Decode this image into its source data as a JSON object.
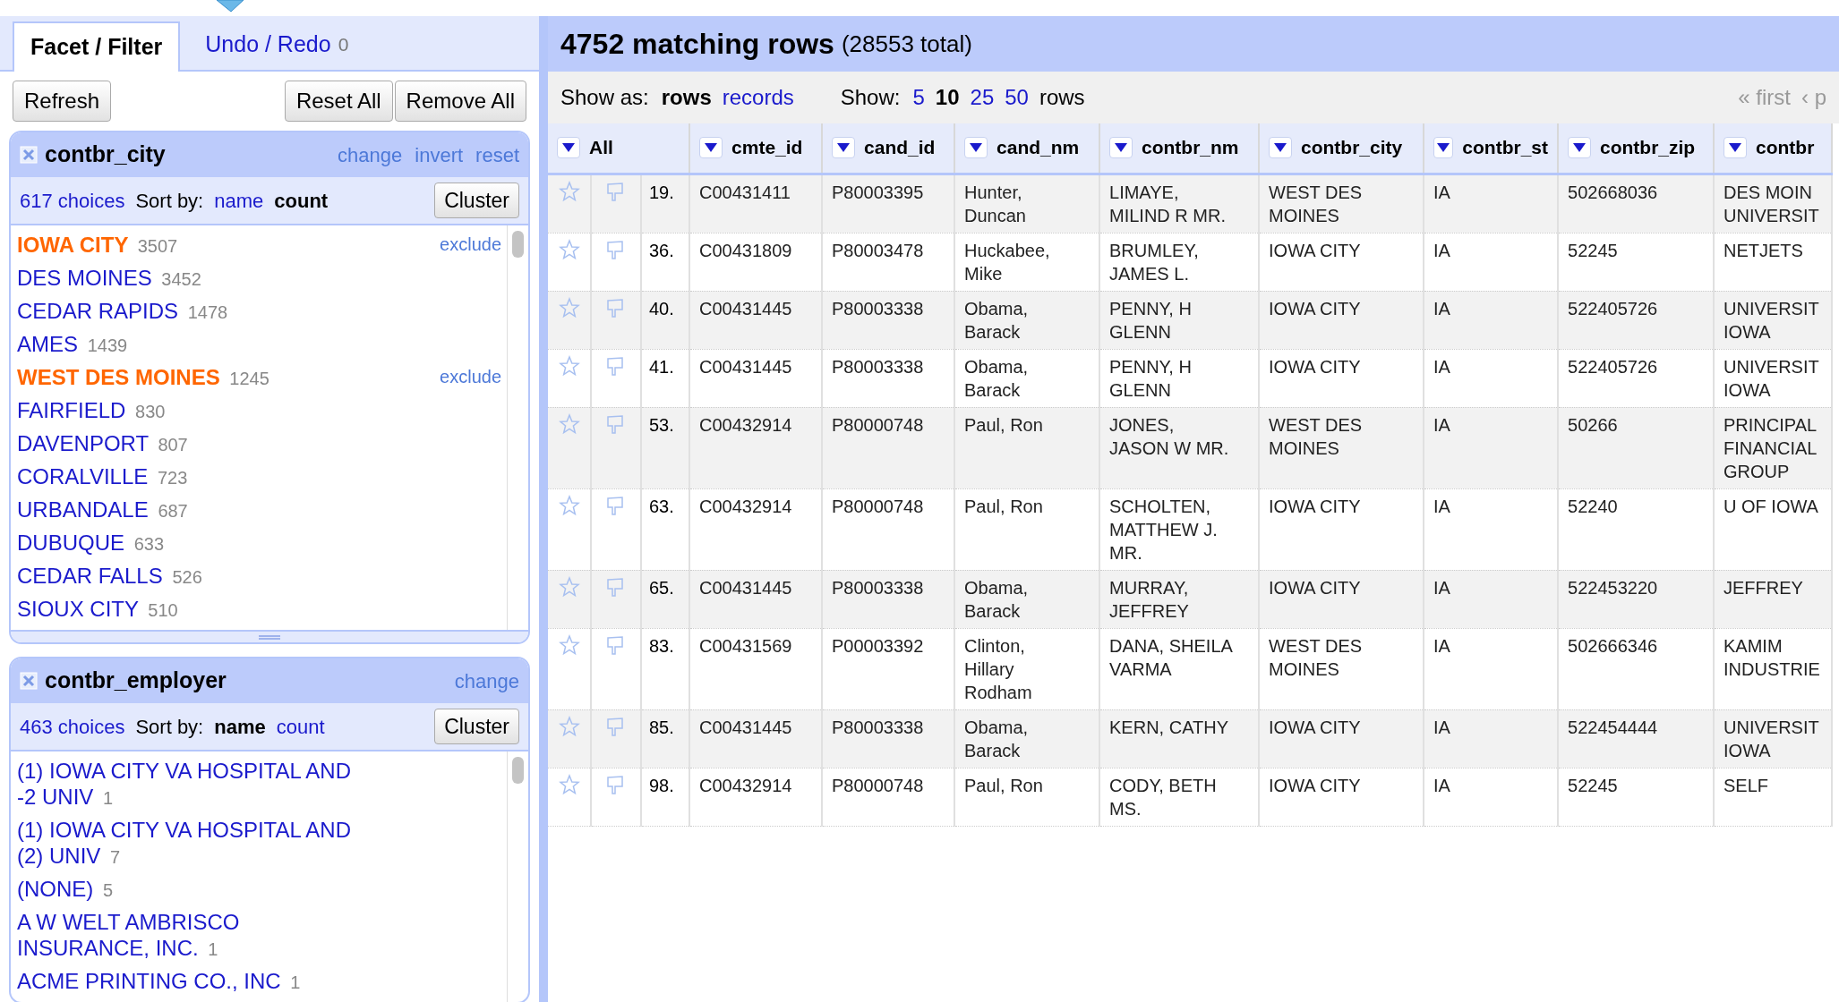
{
  "tabs": [
    {
      "label": "Facet / Filter",
      "selected": true
    },
    {
      "label": "Undo / Redo",
      "count": "0",
      "selected": false
    }
  ],
  "buttons": {
    "left": [
      "Refresh"
    ],
    "right": [
      "Reset All",
      "Remove All"
    ]
  },
  "facets": [
    {
      "title": "contbr_city",
      "actions": [
        "change",
        "invert",
        "reset"
      ],
      "choices": "617 choices",
      "sort_label": "Sort by:",
      "sort": [
        {
          "label": "name",
          "selected": false
        },
        {
          "label": "count",
          "selected": true
        }
      ],
      "cluster": "Cluster",
      "items": [
        {
          "name": "IOWA CITY",
          "count": "3507",
          "selected": true,
          "exclude": "exclude"
        },
        {
          "name": "DES MOINES",
          "count": "3452",
          "selected": false
        },
        {
          "name": "CEDAR RAPIDS",
          "count": "1478",
          "selected": false
        },
        {
          "name": "AMES",
          "count": "1439",
          "selected": false
        },
        {
          "name": "WEST DES MOINES",
          "count": "1245",
          "selected": true,
          "exclude": "exclude"
        },
        {
          "name": "FAIRFIELD",
          "count": "830",
          "selected": false
        },
        {
          "name": "DAVENPORT",
          "count": "807",
          "selected": false
        },
        {
          "name": "CORALVILLE",
          "count": "723",
          "selected": false
        },
        {
          "name": "URBANDALE",
          "count": "687",
          "selected": false
        },
        {
          "name": "DUBUQUE",
          "count": "633",
          "selected": false
        },
        {
          "name": "CEDAR FALLS",
          "count": "526",
          "selected": false
        },
        {
          "name": "SIOUX CITY",
          "count": "510",
          "selected": false
        }
      ]
    },
    {
      "title": "contbr_employer",
      "actions": [
        "change"
      ],
      "choices": "463 choices",
      "sort_label": "Sort by:",
      "sort": [
        {
          "label": "name",
          "selected": true
        },
        {
          "label": "count",
          "selected": false
        }
      ],
      "cluster": "Cluster",
      "items": [
        {
          "name": "(1) IOWA CITY VA HOSPITAL AND -2 UNIV",
          "count": "1",
          "selected": false
        },
        {
          "name": "(1) IOWA CITY VA HOSPITAL AND (2) UNIV",
          "count": "7",
          "selected": false
        },
        {
          "name": "(NONE)",
          "count": "5",
          "selected": false
        },
        {
          "name": "A W WELT AMBRISCO INSURANCE, INC.",
          "count": "1",
          "selected": false
        },
        {
          "name": "ACME PRINTING CO., INC",
          "count": "1",
          "selected": false
        }
      ]
    }
  ],
  "summary": {
    "matching": "4752 matching rows",
    "total": "(28553 total)"
  },
  "view": {
    "show_as_label": "Show as:",
    "modes": [
      {
        "label": "rows",
        "selected": true
      },
      {
        "label": "records",
        "selected": false
      }
    ],
    "show_label": "Show:",
    "page_sizes": [
      {
        "label": "5",
        "selected": false
      },
      {
        "label": "10",
        "selected": true
      },
      {
        "label": "25",
        "selected": false
      },
      {
        "label": "50",
        "selected": false
      }
    ],
    "rows_label": "rows",
    "pager": [
      "« first",
      "‹ p"
    ]
  },
  "table": {
    "columns": [
      "All",
      "cmte_id",
      "cand_id",
      "cand_nm",
      "contbr_nm",
      "contbr_city",
      "contbr_st",
      "contbr_zip",
      "contbr"
    ],
    "rows": [
      {
        "starred": false,
        "flagged": false,
        "cells": [
          "19.",
          "C00431411",
          "P80003395",
          "Hunter,\nDuncan",
          "LIMAYE,\nMILIND R MR.",
          "WEST DES\nMOINES",
          "IA",
          "502668036",
          "DES MOIN\nUNIVERSIT"
        ]
      },
      {
        "starred": false,
        "flagged": false,
        "cells": [
          "36.",
          "C00431809",
          "P80003478",
          "Huckabee,\nMike",
          "BRUMLEY,\nJAMES L.",
          "IOWA CITY",
          "IA",
          "52245",
          "NETJETS"
        ]
      },
      {
        "starred": false,
        "flagged": false,
        "cells": [
          "40.",
          "C00431445",
          "P80003338",
          "Obama,\nBarack",
          "PENNY, H\nGLENN",
          "IOWA CITY",
          "IA",
          "522405726",
          "UNIVERSIT\nIOWA"
        ]
      },
      {
        "starred": false,
        "flagged": false,
        "cells": [
          "41.",
          "C00431445",
          "P80003338",
          "Obama,\nBarack",
          "PENNY, H\nGLENN",
          "IOWA CITY",
          "IA",
          "522405726",
          "UNIVERSIT\nIOWA"
        ]
      },
      {
        "starred": false,
        "flagged": false,
        "cells": [
          "53.",
          "C00432914",
          "P80000748",
          "Paul, Ron",
          "JONES,\nJASON W MR.",
          "WEST DES\nMOINES",
          "IA",
          "50266",
          "PRINCIPAL\nFINANCIAL\nGROUP"
        ]
      },
      {
        "starred": false,
        "flagged": false,
        "cells": [
          "63.",
          "C00432914",
          "P80000748",
          "Paul, Ron",
          "SCHOLTEN,\nMATTHEW J.\nMR.",
          "IOWA CITY",
          "IA",
          "52240",
          "U OF IOWA"
        ]
      },
      {
        "starred": false,
        "flagged": false,
        "cells": [
          "65.",
          "C00431445",
          "P80003338",
          "Obama,\nBarack",
          "MURRAY,\nJEFFREY",
          "IOWA CITY",
          "IA",
          "522453220",
          "JEFFREY"
        ]
      },
      {
        "starred": false,
        "flagged": false,
        "cells": [
          "83.",
          "C00431569",
          "P00003392",
          "Clinton,\nHillary\nRodham",
          "DANA, SHEILA\nVARMA",
          "WEST DES\nMOINES",
          "IA",
          "502666346",
          "KAMIM\nINDUSTRIE"
        ]
      },
      {
        "starred": false,
        "flagged": false,
        "cells": [
          "85.",
          "C00431445",
          "P80003338",
          "Obama,\nBarack",
          "KERN, CATHY",
          "IOWA CITY",
          "IA",
          "522454444",
          "UNIVERSIT\nIOWA"
        ]
      },
      {
        "starred": false,
        "flagged": false,
        "cells": [
          "98.",
          "C00432914",
          "P80000748",
          "Paul, Ron",
          "CODY, BETH\nMS.",
          "IOWA CITY",
          "IA",
          "52245",
          "SELF"
        ]
      }
    ]
  }
}
